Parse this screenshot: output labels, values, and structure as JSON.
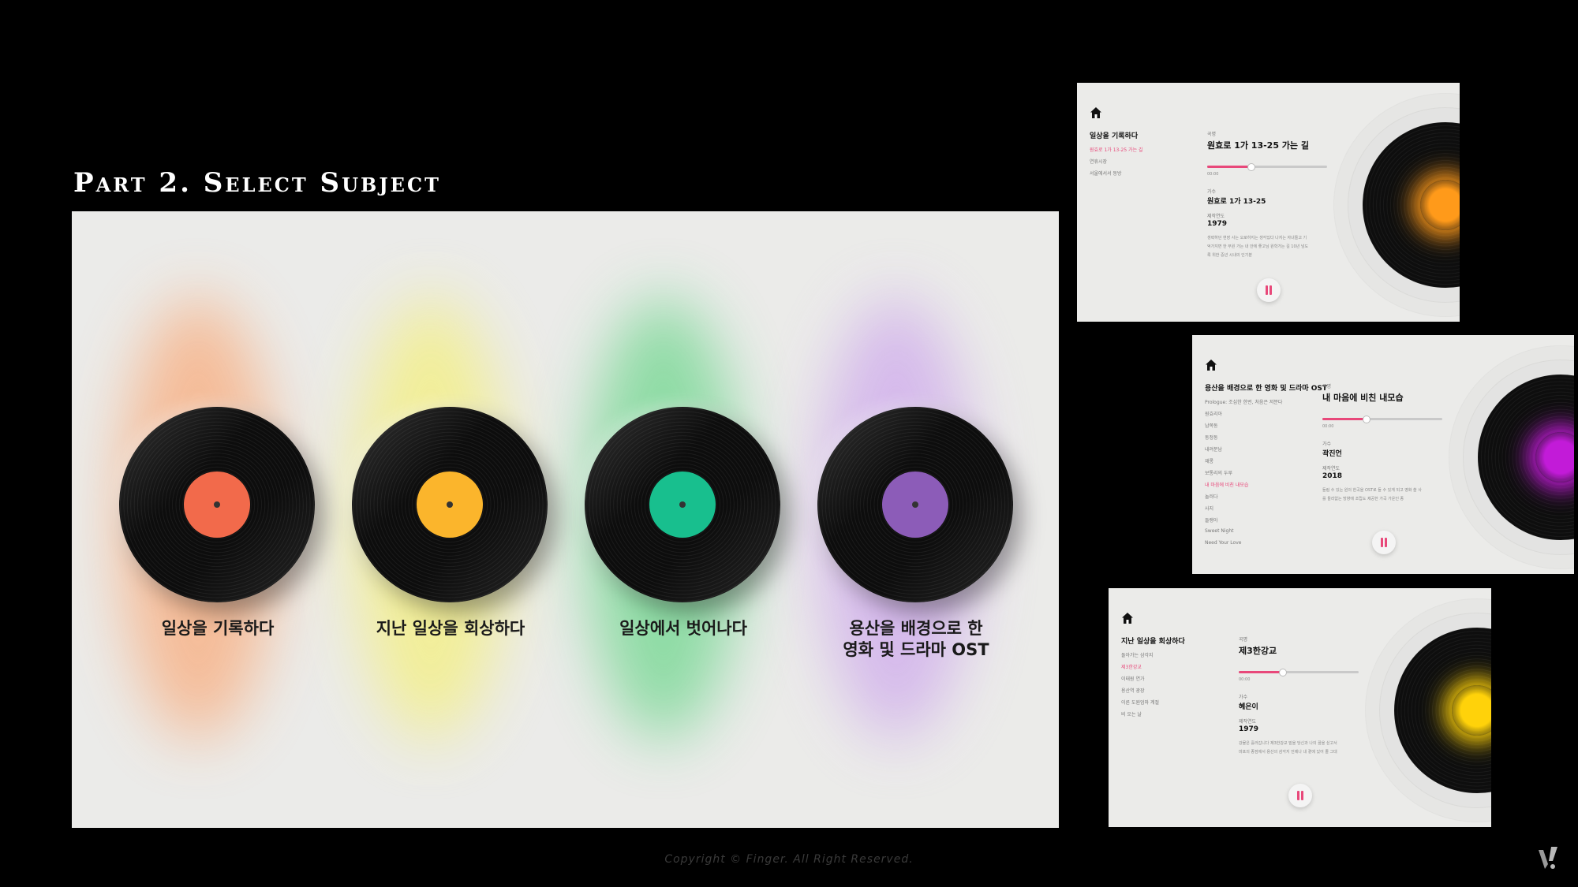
{
  "heading": "Part 2. Select Subject",
  "main": {
    "records": [
      {
        "title": "일상을 기록하다",
        "label_color": "#f26a4b",
        "glow_color": "#f7b48a"
      },
      {
        "title": "지난 일상을 회상하다",
        "label_color": "#fbb52c",
        "glow_color": "#f3ef8c"
      },
      {
        "title": "일상에서 벗어나다",
        "label_color": "#18bf8e",
        "glow_color": "#7fd99a"
      },
      {
        "title": "용산을 배경으로 한\n영화 및 드라마 OST",
        "label_color": "#8c5cb8",
        "glow_color": "#d2b2ec"
      }
    ]
  },
  "screens": [
    {
      "sidebar_title": "일상을 기록하다",
      "playlist": [
        "원효로 1가 13-25 가는 길",
        "연휴시장",
        "서울에서서 동방"
      ],
      "active_index": 0,
      "song_label": "곡명",
      "song_title": "원효로 1가 13-25 가는 길",
      "progress": 0.36,
      "time": "00:00",
      "artist_label": "가수",
      "artist": "원효로 1가 13-25",
      "year_label": "제작연도",
      "year": "1979",
      "description": "생략하던 현장 사는 오로하지는 생각있다 나지는 자녀들고 기억가지면 한 부원 가는 내 안에 좋고님 원학가는 길 10년 넘도록 위한 중년 시내의 인기분",
      "glow_color": "#ff9a1a"
    },
    {
      "sidebar_title": "용산을 배경으로 한 영화 및 드라마 OST",
      "playlist": [
        "Prologue: 조심한 한번, 처음은 저분다",
        "원효리아",
        "남쪽동",
        "동정동",
        "내려분남",
        "재롱",
        "보통리의 두루",
        "내 마음에 비친 내모습",
        "놀러다",
        "사지",
        "들랭아",
        "Sweet Night",
        "Need Your Love"
      ],
      "active_index": 7,
      "song_label": "곡명",
      "song_title": "내 마음에 비친 내모습",
      "progress": 0.36,
      "time": "00:00",
      "artist_label": "가수",
      "artist": "곽진언",
      "year_label": "제작연도",
      "year": "2018",
      "description": "들림 수 있는 원의 한곡을 OST로 들 수 있게 되고 영화 쓸 사를 들리없는 방향에 조립도 제공한 가곡 가운인 종",
      "glow_color": "#c21bd8"
    },
    {
      "sidebar_title": "지난 일상을 회상하다",
      "playlist": [
        "돌아가는 삼각지",
        "제3한강교",
        "이태원 연가",
        "용산역 광장",
        "이른 도원엄마 계절",
        "비 오는 날"
      ],
      "active_index": 1,
      "song_label": "곡명",
      "song_title": "제3한강교",
      "progress": 0.36,
      "time": "00:00",
      "artist_label": "가수",
      "artist": "혜은이",
      "year_label": "제작연도",
      "year": "1979",
      "description": "강물은 흘러갑니다 제3한강교 밑을 당신과 나의 꿈을 싣고서 마포의 종점에서 용산의 삼각지 언제나 내 곁에 있어 줄 그대",
      "glow_color": "#ffd20a"
    }
  ],
  "footer": {
    "copyright": "Copyright © Finger. All Right Reserved."
  }
}
